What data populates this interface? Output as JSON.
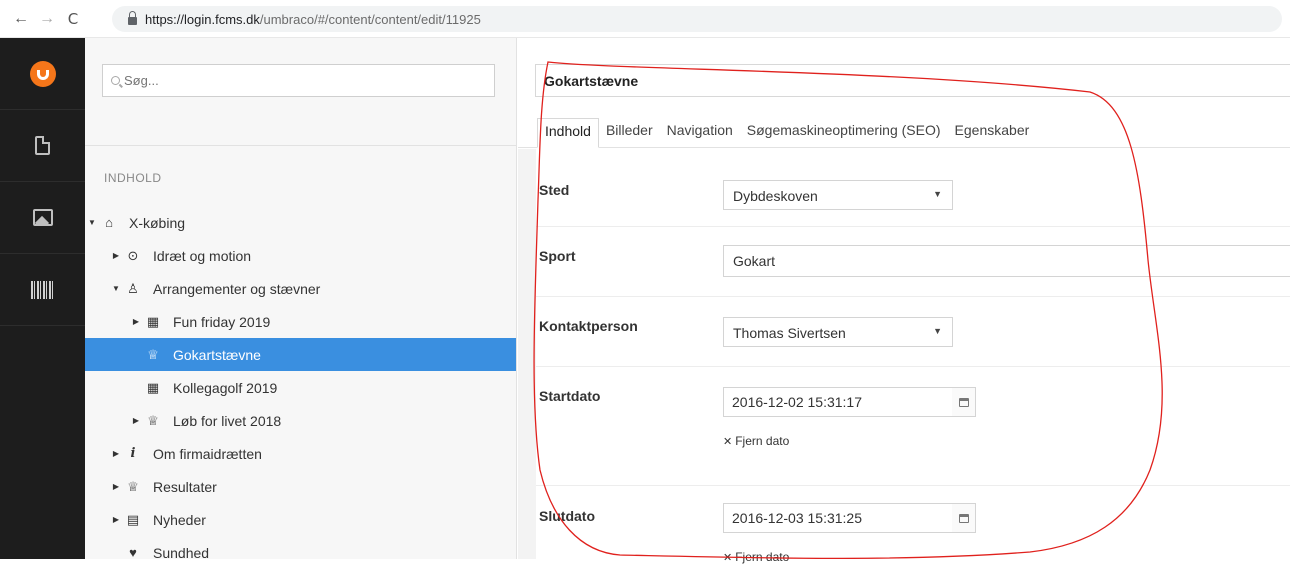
{
  "browser": {
    "back": "←",
    "forward": "→",
    "reload": "C",
    "url_host": "https://login.fcms.dk",
    "url_path": "/umbraco/#/content/content/edit/11925"
  },
  "rail": {
    "items": [
      "umbraco-logo",
      "content-icon",
      "media-icon",
      "barcode-icon"
    ]
  },
  "tree": {
    "search_placeholder": "Søg...",
    "section_label": "INDHOLD",
    "nodes": [
      {
        "label": "X-købing",
        "icon": "home-icon",
        "caret": "▼"
      },
      {
        "label": "Idræt og motion",
        "icon": "sport-icon",
        "caret": "▶"
      },
      {
        "label": "Arrangementer og stævner",
        "icon": "award-icon",
        "caret": "▼"
      },
      {
        "label": "Fun friday 2019",
        "icon": "calendar-icon",
        "caret": "▶"
      },
      {
        "label": "Gokartstævne",
        "icon": "trophy-icon",
        "caret": ""
      },
      {
        "label": "Kollegagolf 2019",
        "icon": "calendar-icon",
        "caret": ""
      },
      {
        "label": "Løb for livet 2018",
        "icon": "trophy-icon",
        "caret": "▶"
      },
      {
        "label": "Om firmaidrætten",
        "icon": "info-icon",
        "caret": "▶"
      },
      {
        "label": "Resultater",
        "icon": "trophy-icon",
        "caret": "▶"
      },
      {
        "label": "Nyheder",
        "icon": "news-icon",
        "caret": "▶"
      },
      {
        "label": "Sundhed",
        "icon": "heart-icon",
        "caret": ""
      }
    ]
  },
  "editor": {
    "doc_name": "Gokartstævne",
    "tabs": [
      "Indhold",
      "Billeder",
      "Navigation",
      "Søgemaskineoptimering (SEO)",
      "Egenskaber"
    ],
    "active_tab": "Indhold",
    "props": {
      "sted_label": "Sted",
      "sted_value": "Dybdeskoven",
      "sport_label": "Sport",
      "sport_value": "Gokart",
      "kontakt_label": "Kontaktperson",
      "kontakt_value": "Thomas Sivertsen",
      "start_label": "Startdato",
      "start_value": "2016-12-02 15:31:17",
      "remove_date": "Fjern dato",
      "slut_label": "Slutdato",
      "slut_value": "2016-12-03 15:31:25",
      "remove_date_2": "Fjern dato"
    }
  },
  "colors": {
    "accent_selected": "#3a8fe0",
    "rail_bg": "#1d1d1d",
    "logo_orange": "#f5761a",
    "annotation": "#e0211d"
  }
}
